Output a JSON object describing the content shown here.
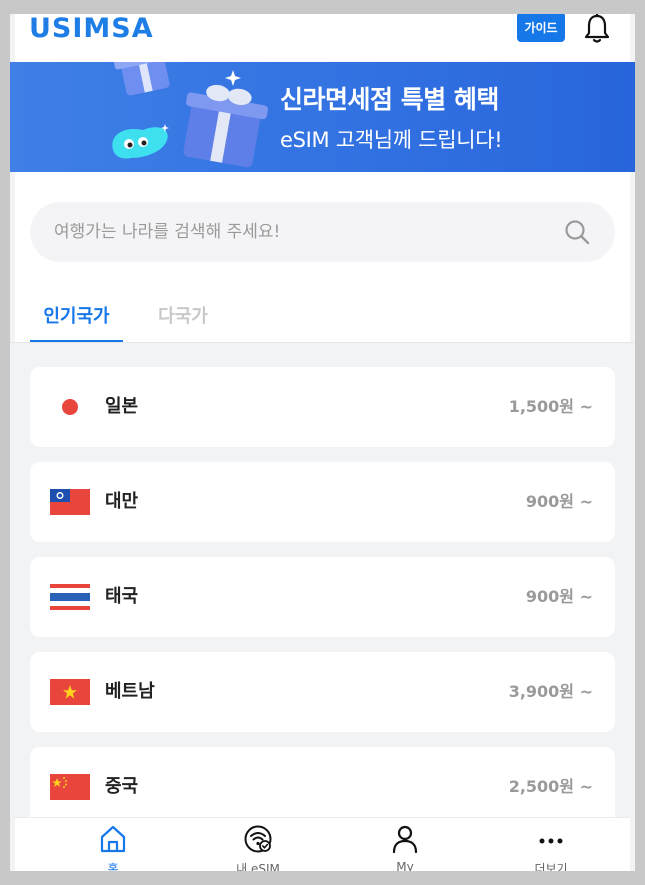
{
  "header": {
    "logo": "USIMSA",
    "guide_label": "가이드",
    "bell_icon": "bell-icon"
  },
  "banner": {
    "title": "신라면세점 특별 혜택",
    "subtitle": "eSIM 고객님께 드립니다!"
  },
  "search": {
    "placeholder": "여행가는 나라를 검색해 주세요!",
    "icon": "search-icon"
  },
  "tabs": [
    {
      "label": "인기국가",
      "active": true
    },
    {
      "label": "다국가",
      "active": false
    }
  ],
  "countries": [
    {
      "name": "일본",
      "price": "1,500원 ~",
      "flag": "japan"
    },
    {
      "name": "대만",
      "price": "900원 ~",
      "flag": "taiwan"
    },
    {
      "name": "태국",
      "price": "900원 ~",
      "flag": "thailand"
    },
    {
      "name": "베트남",
      "price": "3,900원 ~",
      "flag": "vietnam"
    },
    {
      "name": "중국",
      "price": "2,500원 ~",
      "flag": "china"
    }
  ],
  "bottom_nav": [
    {
      "label": "홈",
      "icon": "home-icon",
      "active": true
    },
    {
      "label": "내 eSIM",
      "icon": "esim-icon",
      "active": false
    },
    {
      "label": "My",
      "icon": "user-icon",
      "active": false
    },
    {
      "label": "더보기",
      "icon": "more-icon",
      "active": false
    }
  ],
  "colors": {
    "accent": "#1677e8",
    "banner": "#3373e2",
    "price": "#9a9a9a"
  }
}
